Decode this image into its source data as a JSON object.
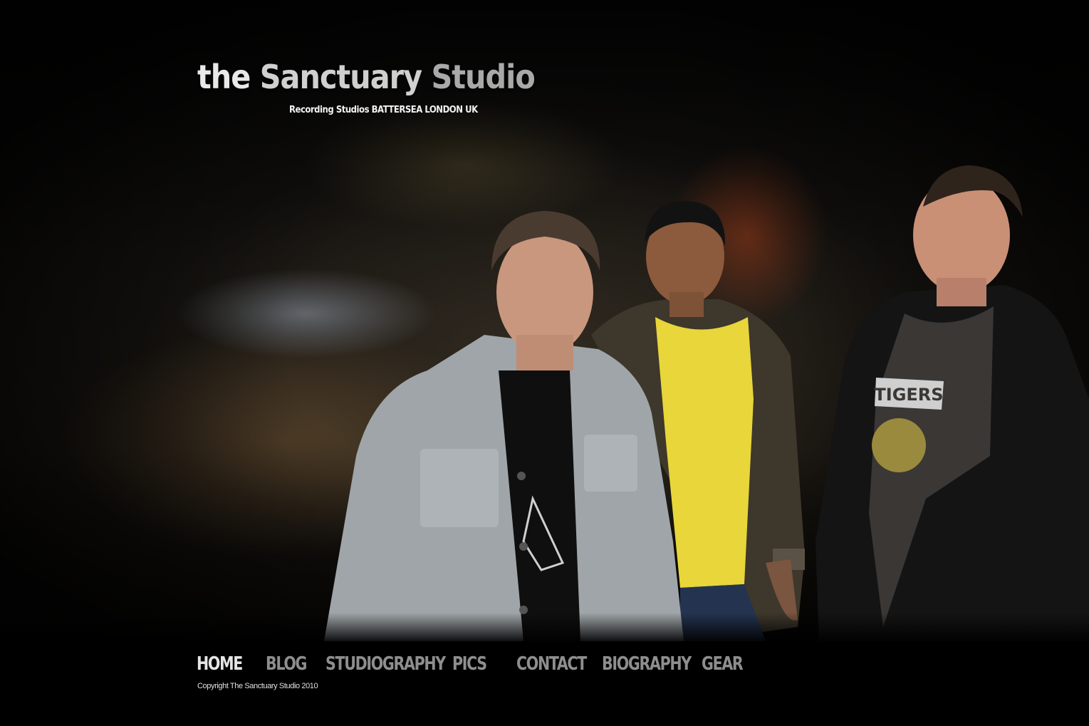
{
  "header": {
    "title_part1": "the",
    "title_part2": "Sanctuary",
    "title_part3": "Studio",
    "tagline": "Recording Studios BATTERSEA LONDON UK"
  },
  "hero": {
    "shirt_text": "TIGERS",
    "photo_description_alt": "the Sanctuary Studio"
  },
  "nav": {
    "items": [
      {
        "label": "HOME",
        "active": true
      },
      {
        "label": "BLOG",
        "active": false
      },
      {
        "label": "STUDIOGRAPHY",
        "active": false
      },
      {
        "label": "PICS",
        "active": false
      },
      {
        "label": "CONTACT",
        "active": false
      },
      {
        "label": "BIOGRAPHY",
        "active": false
      },
      {
        "label": "GEAR",
        "active": false
      }
    ]
  },
  "footer": {
    "copyright": "Copyright The Sanctuary Studio 2010"
  },
  "colors": {
    "background": "#000000",
    "nav_inactive": "#8e8e8e",
    "nav_active": "#e4e4e4",
    "shirt_yellow": "#e8d63a"
  }
}
